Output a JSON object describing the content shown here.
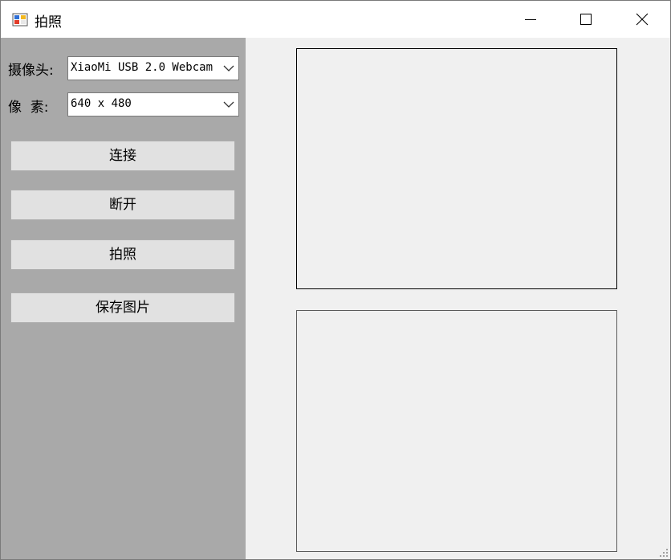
{
  "window": {
    "title": "拍照",
    "icons": {
      "app": "app-icon",
      "minimize": "minimize-icon",
      "maximize": "maximize-icon",
      "close": "close-icon"
    }
  },
  "left_panel": {
    "background": "#a9a9a9",
    "camera": {
      "label": "摄像头:",
      "value": "XiaoMi USB 2.0 Webcam"
    },
    "resolution": {
      "label": "像  素:",
      "value": "640 x 480"
    },
    "buttons": {
      "connect": "连接",
      "disconnect": "断开",
      "capture": "拍照",
      "save": "保存图片"
    }
  },
  "main": {
    "preview_box": "",
    "photo_box": ""
  },
  "colors": {
    "window_bg": "#f0f0f0",
    "titlebar_bg": "#ffffff",
    "button_bg": "#e1e1e1"
  }
}
